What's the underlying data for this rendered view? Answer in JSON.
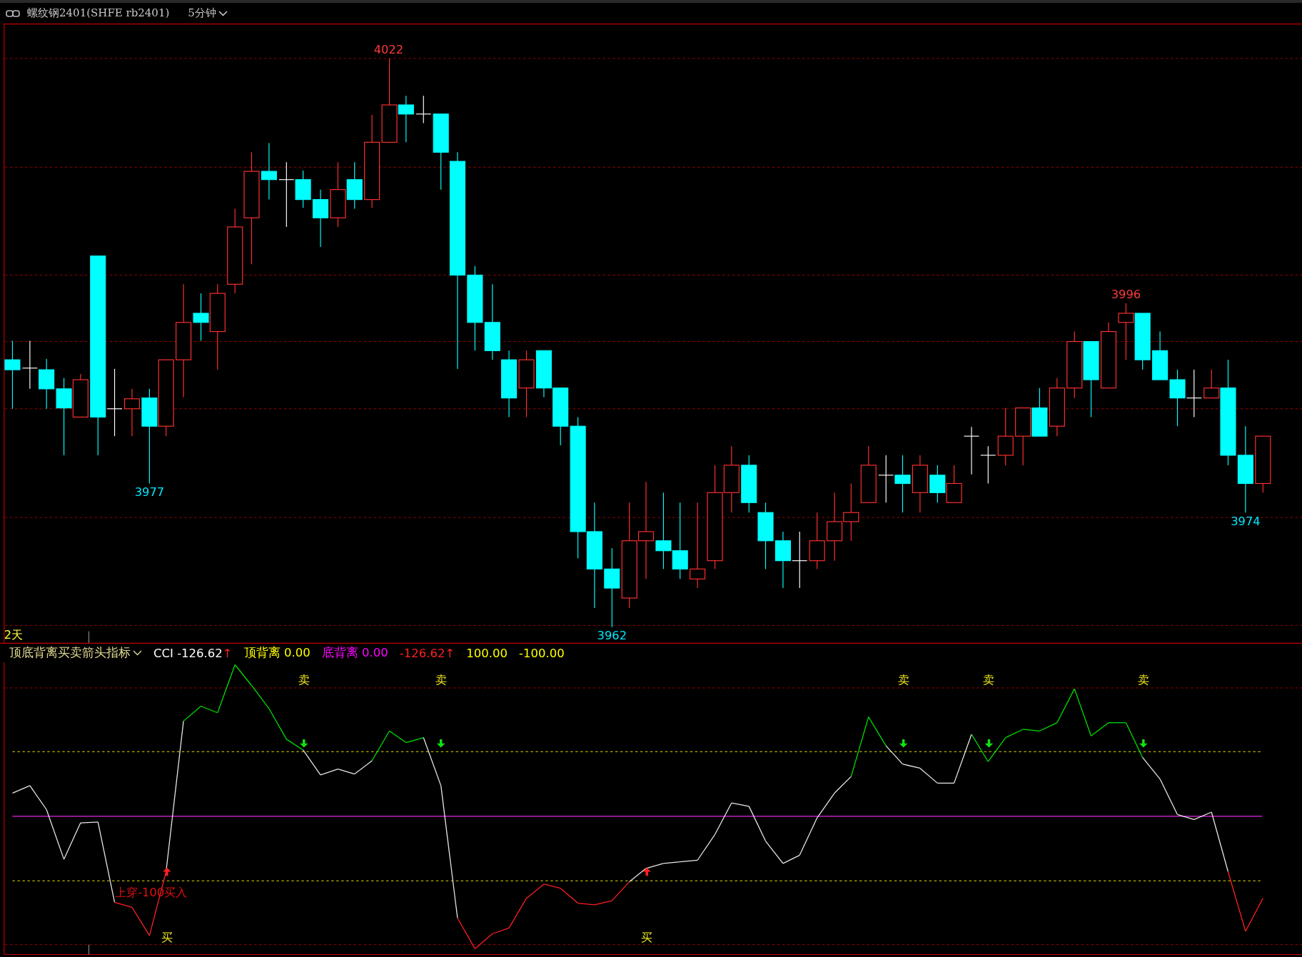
{
  "header": {
    "title": "螺纹钢2401(SHFE rb2401)",
    "period": "5分钟"
  },
  "main_chart": {
    "range_label": "2天",
    "price_labels": [
      {
        "text": "4022",
        "kind": "high"
      },
      {
        "text": "3977",
        "kind": "low"
      },
      {
        "text": "3962",
        "kind": "low"
      },
      {
        "text": "3996",
        "kind": "high"
      },
      {
        "text": "3974",
        "kind": "low"
      }
    ]
  },
  "indicator": {
    "name": "顶底背离买卖箭头指标",
    "legend": [
      {
        "label": "CCI",
        "value": "-126.62",
        "arrow": "↑",
        "color": "#ffffff"
      },
      {
        "label": "顶背离",
        "value": "0.00",
        "color": "#ffff00"
      },
      {
        "label": "底背离",
        "value": "0.00",
        "color": "#ff00ff"
      },
      {
        "value": "-126.62",
        "arrow": "↑",
        "color": "#ff2020"
      },
      {
        "value": "100.00",
        "color": "#ffff00"
      },
      {
        "value": "-100.00",
        "color": "#ffff00"
      }
    ],
    "signals": [
      {
        "text": "上穿-100买入",
        "kind": "note"
      },
      {
        "text": "买",
        "kind": "buy"
      },
      {
        "text": "卖",
        "kind": "sell"
      },
      {
        "text": "卖",
        "kind": "sell"
      },
      {
        "text": "买",
        "kind": "buy"
      },
      {
        "text": "卖",
        "kind": "sell"
      },
      {
        "text": "卖",
        "kind": "sell"
      },
      {
        "text": "卖",
        "kind": "sell"
      }
    ]
  }
}
